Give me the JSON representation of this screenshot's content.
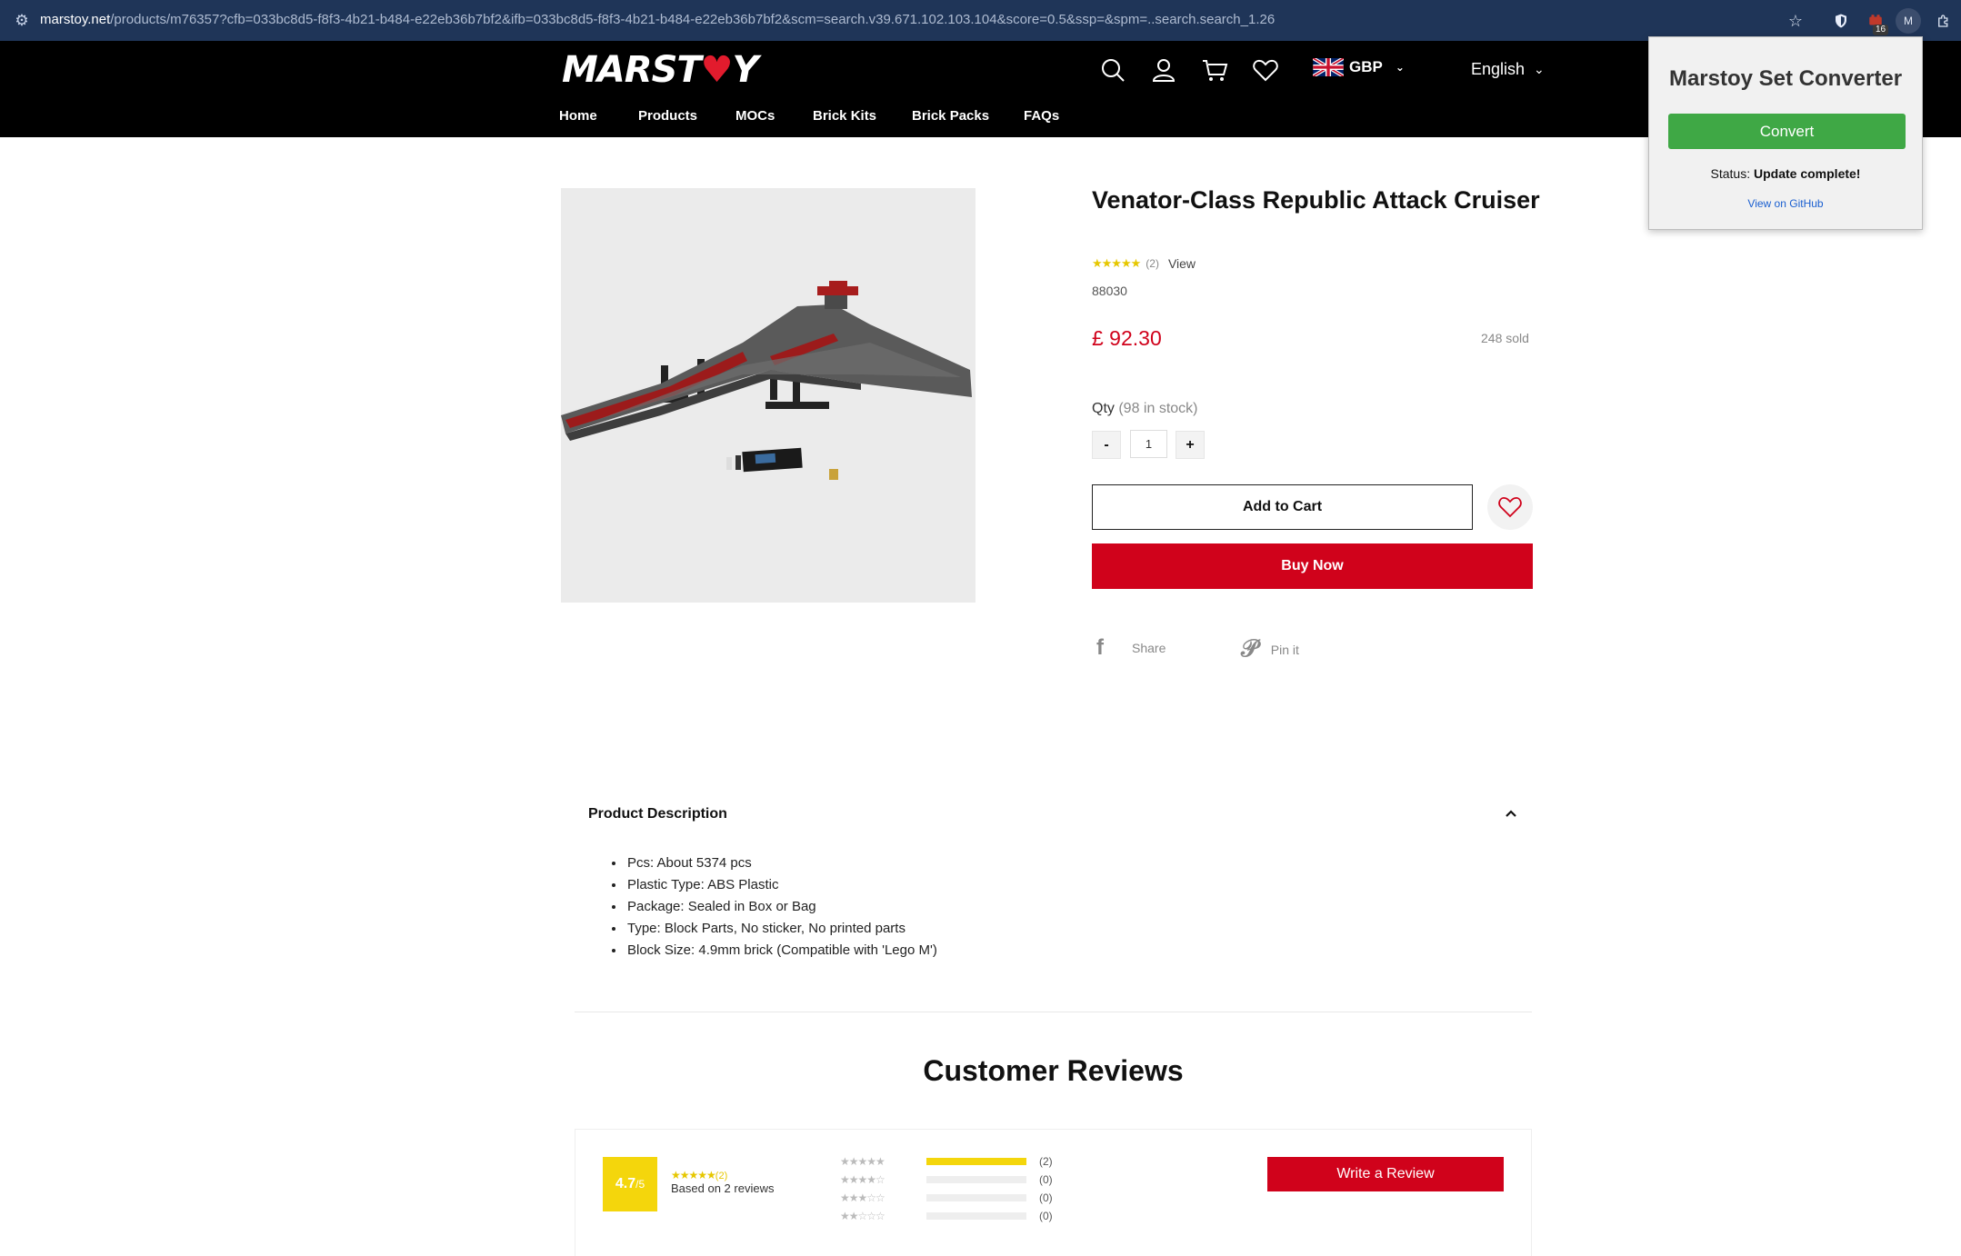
{
  "browser": {
    "url_host": "marstoy.net",
    "url_path": "/products/m76357?cfb=033bc8d5-f8f3-4b21-b484-e22eb36b7bf2&ifb=033bc8d5-f8f3-4b21-b484-e22eb36b7bf2&scm=search.v39.671.102.103.104&score=0.5&ssp=&spm=..search.search_1.26",
    "extension_badge": "16",
    "profile_initial": "M"
  },
  "header": {
    "logo": "MARSTOY",
    "currency": "GBP",
    "language": "English",
    "nav": [
      "Home",
      "Products",
      "MOCs",
      "Brick Kits",
      "Brick Packs",
      "FAQs"
    ]
  },
  "extension_popup": {
    "title": "Marstoy Set Converter",
    "convert_label": "Convert",
    "status_label": "Status:",
    "status_value": "Update complete!",
    "github_link": "View on GitHub"
  },
  "product": {
    "title": "Venator-Class Republic Attack Cruiser",
    "rating_stars": "★★★★★",
    "rating_count": "(2)",
    "rating_view": "View",
    "sku": "88030",
    "price": "£ 92.30",
    "sold": "248 sold",
    "qty_label": "Qty",
    "stock": "(98 in stock)",
    "qty_minus": "-",
    "qty_value": "1",
    "qty_plus": "+",
    "add_to_cart": "Add to Cart",
    "buy_now": "Buy Now",
    "share_label": "Share",
    "pin_label": "Pin it"
  },
  "description": {
    "title": "Product Description",
    "items": [
      "Pcs: About 5374 pcs",
      "Plastic Type:  ABS Plastic",
      "Package: Sealed in Box or Bag",
      "Type: Block Parts, No sticker, No printed parts",
      "Block Size: 4.9mm brick (Compatible with 'Lego M')"
    ]
  },
  "reviews": {
    "title": "Customer Reviews",
    "score": "4.7",
    "score_out_of": "/5",
    "summary_count": "(2)",
    "based_on": "Based on 2 reviews",
    "write_review": "Write a Review",
    "distribution": [
      {
        "stars": "★★★★★",
        "count": "(2)",
        "fraction": 1.0
      },
      {
        "stars": "★★★★☆",
        "count": "(0)",
        "fraction": 0
      },
      {
        "stars": "★★★☆☆",
        "count": "(0)",
        "fraction": 0
      },
      {
        "stars": "★★☆☆☆",
        "count": "(0)",
        "fraction": 0
      }
    ]
  },
  "colors": {
    "brand_red": "#d0021b",
    "convert_green": "#3fa845",
    "star_yellow": "#f4d60c",
    "header_black": "#000000"
  }
}
